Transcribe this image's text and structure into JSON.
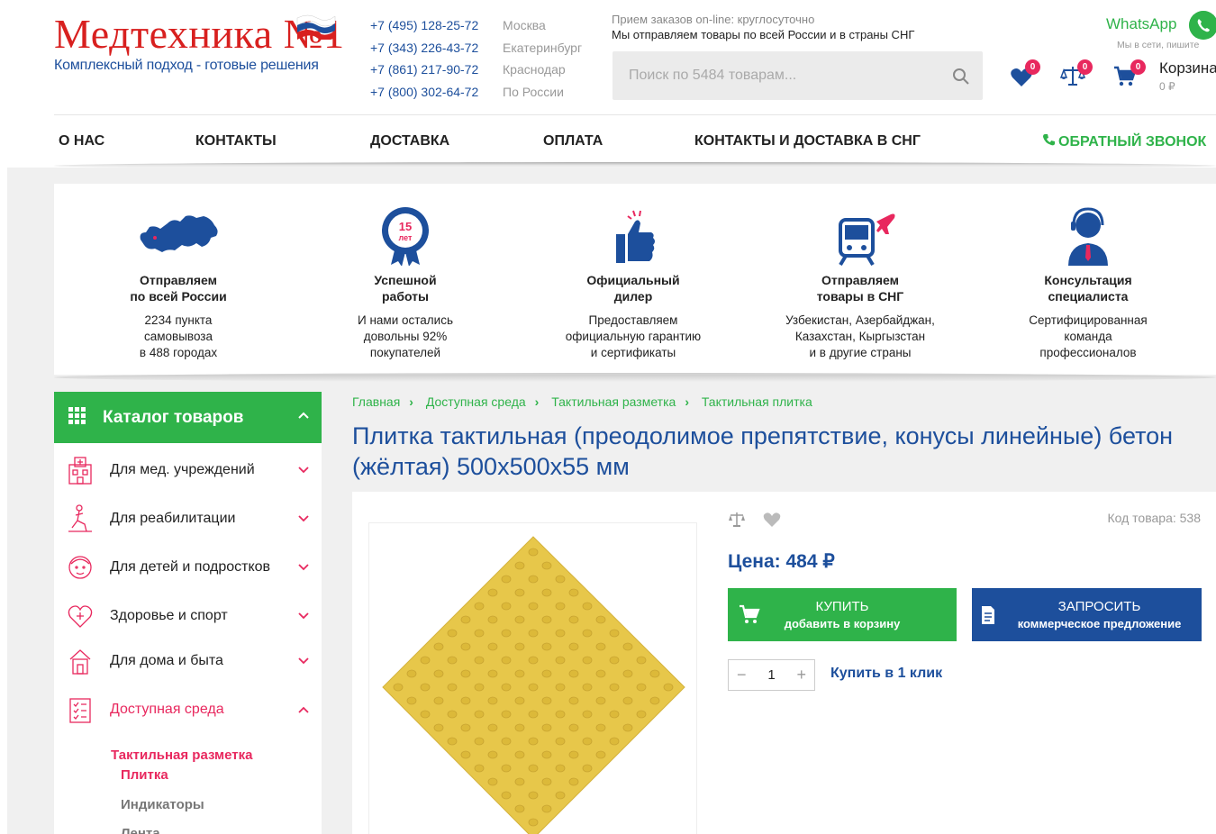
{
  "header": {
    "logo_title": "Медтехника №1",
    "logo_subtitle": "Комплексный подход - готовые решения",
    "phones": [
      "+7 (495) 128-25-72",
      "+7 (343) 226-43-72",
      "+7 (861) 217-90-72",
      "+7 (800) 302-64-72"
    ],
    "cities": [
      "Москва",
      "Екатеринбург",
      "Краснодар",
      "По России"
    ],
    "info_line1": "Прием заказов on-line: круглосуточно",
    "info_line2": "Мы отправляем товары по всей России и в страны СНГ",
    "search_placeholder": "Поиск по 5484 товарам...",
    "whatsapp_title": "WhatsApp",
    "whatsapp_sub": "Мы в сети, пишите",
    "favorites_count": "0",
    "compare_count": "0",
    "cart_count": "0",
    "cart_title": "Корзина",
    "cart_sum": "0 ₽"
  },
  "nav": [
    "О НАС",
    "КОНТАКТЫ",
    "ДОСТАВКА",
    "ОПЛАТА",
    "КОНТАКТЫ И ДОСТАВКА В СНГ"
  ],
  "nav_callback": "ОБРАТНЫЙ ЗВОНОК",
  "features": [
    {
      "icon": "russia-map-icon",
      "title1": "Отправляем",
      "title2": "по всей России",
      "desc1": "2234 пункта",
      "desc2": "самовывоза",
      "desc3": "в 488 городах"
    },
    {
      "icon": "award-15-years-icon",
      "badge": "15 лет",
      "title1": "Успешной",
      "title2": "работы",
      "desc1": "И нами остались",
      "desc2": "довольны 92%",
      "desc3": "покупателей"
    },
    {
      "icon": "thumbs-up-icon",
      "title1": "Официальный",
      "title2": "дилер",
      "desc1": "Предоставляем",
      "desc2": "официальную гарантию",
      "desc3": "и сертификаты"
    },
    {
      "icon": "train-plane-icon",
      "title1": "Отправляем",
      "title2": "товары в СНГ",
      "desc1": "Узбекистан, Азербайджан,",
      "desc2": "Казахстан, Кыргызстан",
      "desc3": "и в другие страны"
    },
    {
      "icon": "consultant-icon",
      "title1": "Консультация",
      "title2": "специалиста",
      "desc1": "Сертифицированная",
      "desc2": "команда",
      "desc3": "профессионалов"
    }
  ],
  "catalog": {
    "title": "Каталог товаров",
    "items": [
      {
        "label": "Для мед. учреждений",
        "icon": "hospital-icon"
      },
      {
        "label": "Для реабилитации",
        "icon": "rehab-icon"
      },
      {
        "label": "Для детей и подростков",
        "icon": "child-icon"
      },
      {
        "label": "Здоровье и спорт",
        "icon": "heart-plus-icon"
      },
      {
        "label": "Для дома и быта",
        "icon": "home-care-icon"
      },
      {
        "label": "Доступная среда",
        "icon": "checklist-icon"
      }
    ],
    "sub_title": "Тактильная разметка",
    "sub_items": [
      "Плитка",
      "Индикаторы",
      "Лента"
    ]
  },
  "breadcrumbs": [
    "Главная",
    "Доступная среда",
    "Тактильная разметка",
    "Тактильная плитка"
  ],
  "product": {
    "title": "Плитка тактильная (преодолимое препятствие, конусы линейные) бетон (жёлтая) 500х500х55 мм",
    "code": "Код товара: 538",
    "price": "Цена: 484 ₽",
    "buy_label": "КУПИТЬ",
    "buy_sub": "добавить в корзину",
    "request_label": "ЗАПРОСИТЬ",
    "request_sub": "коммерческое предложение",
    "quantity": "1",
    "one_click": "Купить в 1 клик"
  },
  "colors": {
    "green": "#2fb34a",
    "blue": "#1d4f9c",
    "red": "#d8201f",
    "pink": "#e8285e"
  }
}
